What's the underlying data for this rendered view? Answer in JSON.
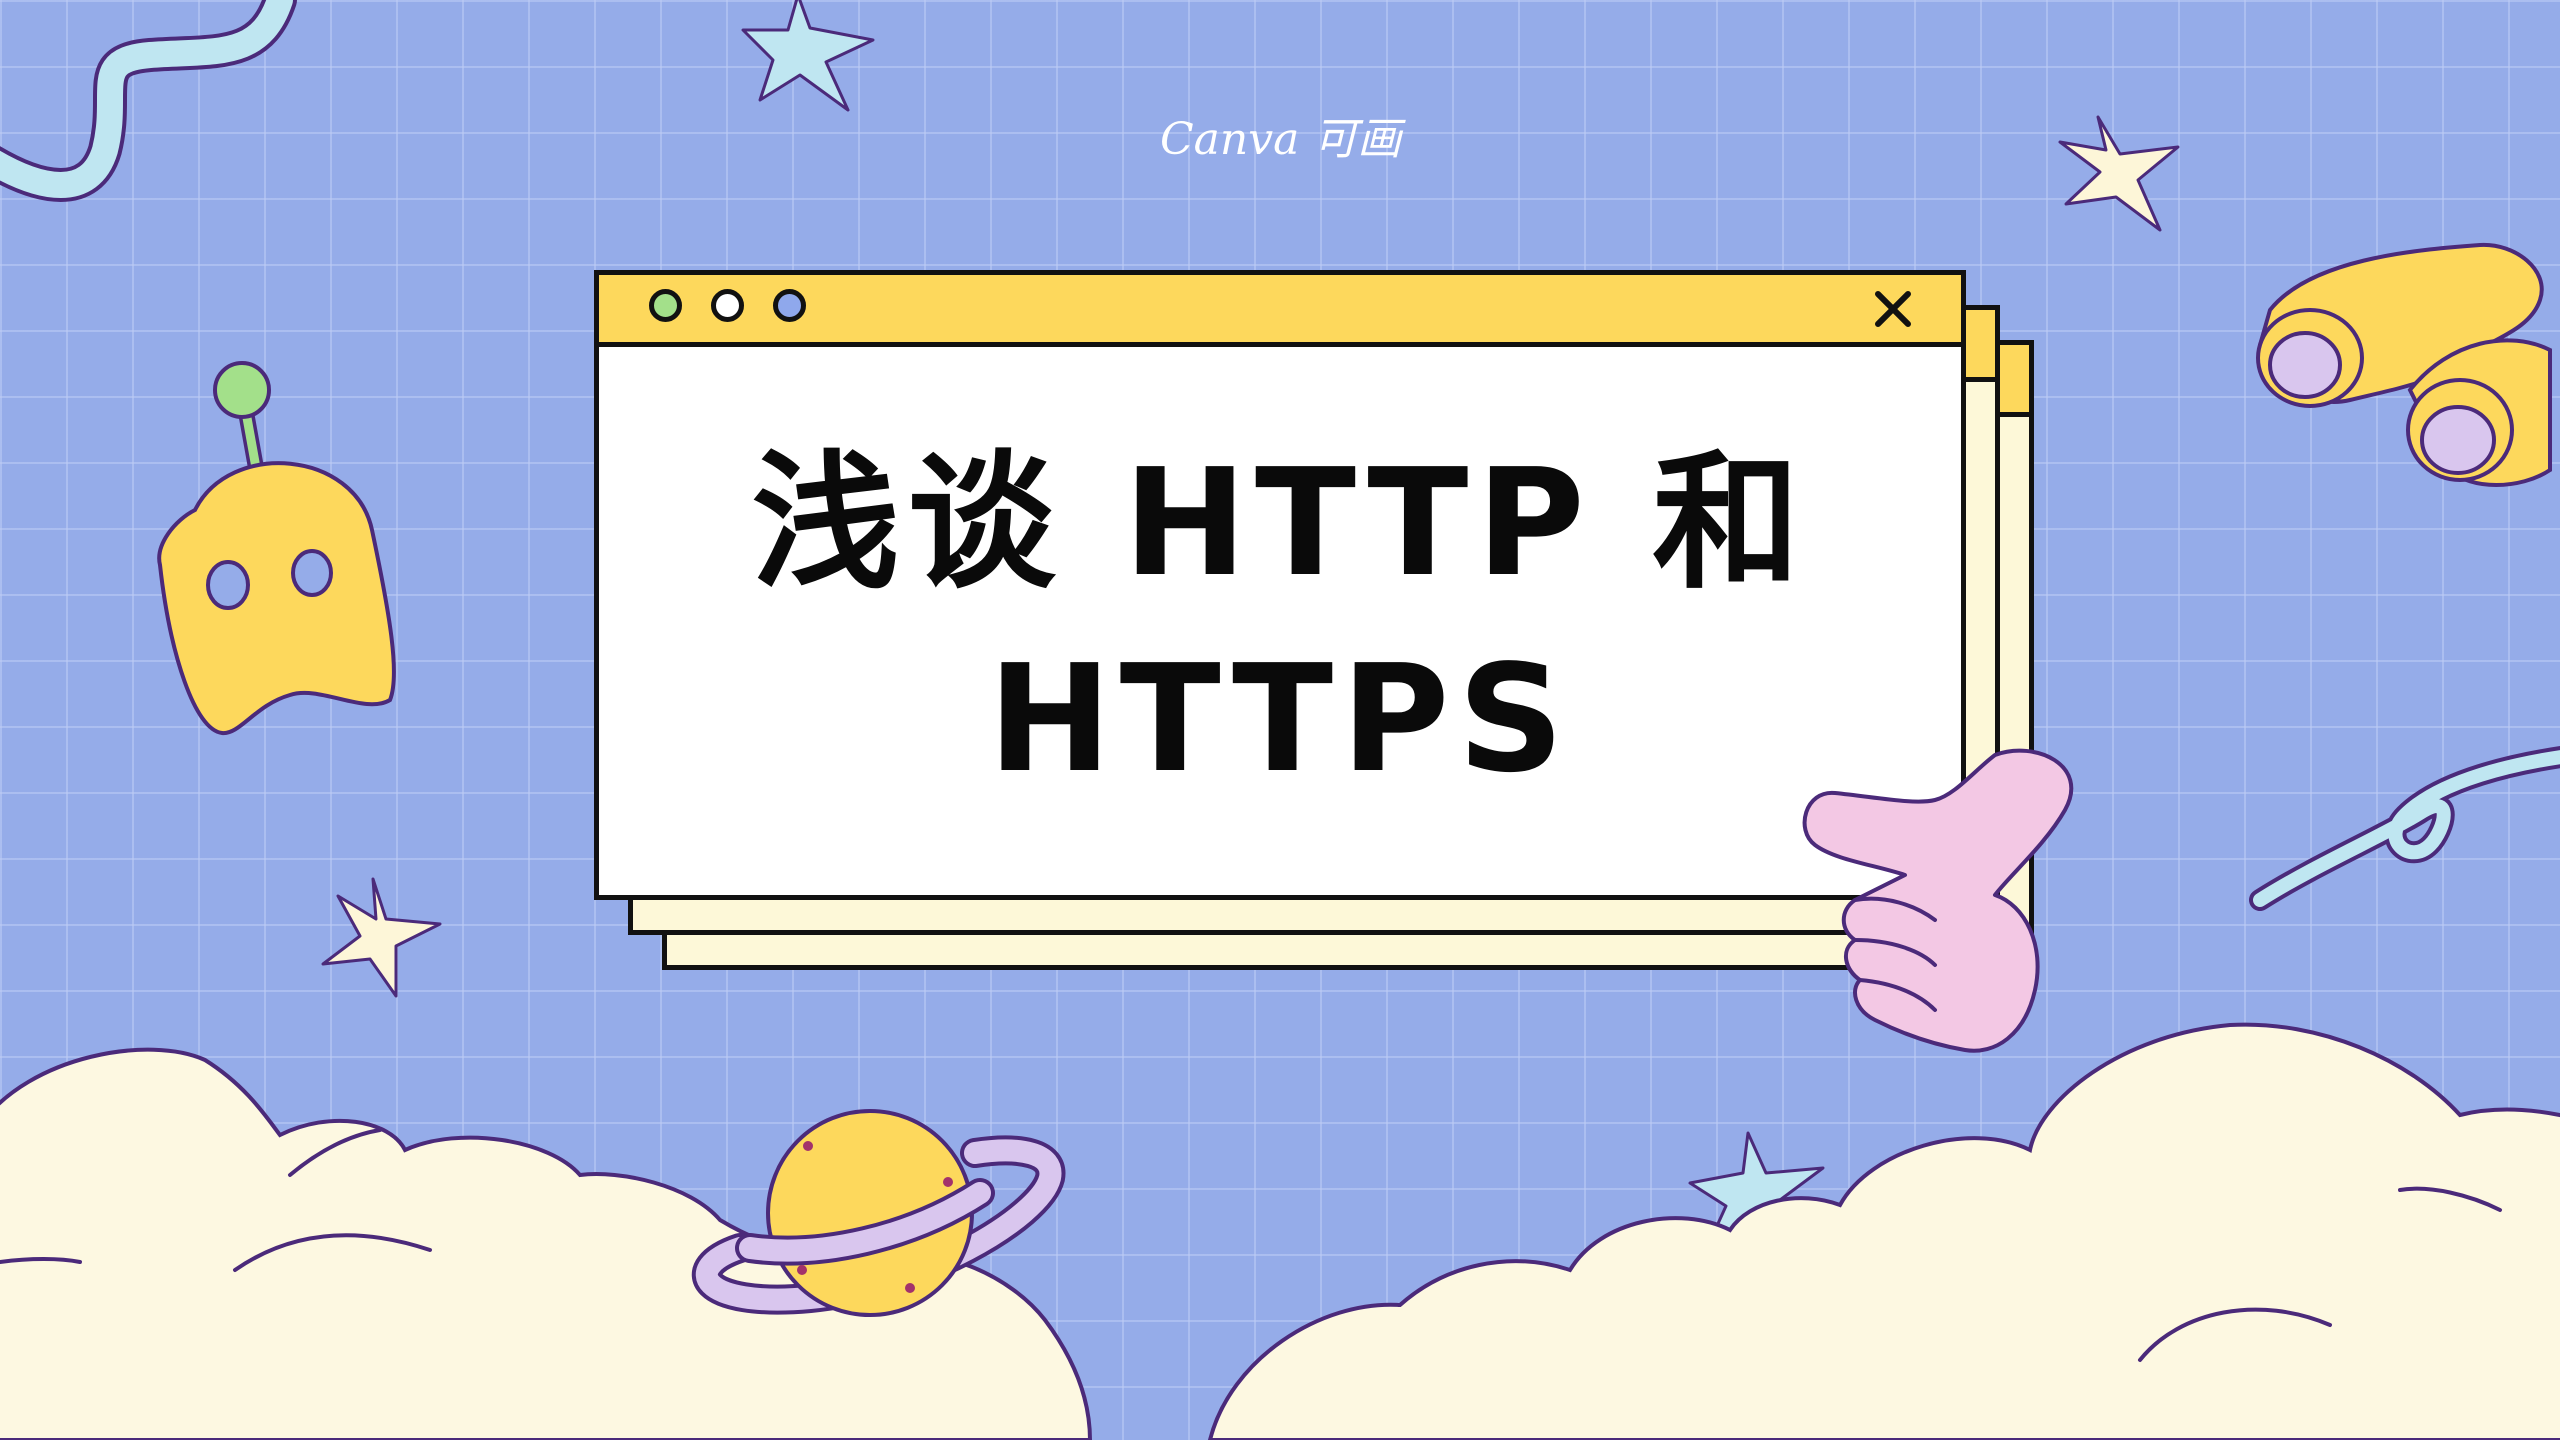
{
  "brand": {
    "logo_text": "Canva 可画"
  },
  "window": {
    "title": "浅谈 HTTP 和\nHTTPS",
    "dots": [
      {
        "name": "green-dot",
        "color": "#a3e08a"
      },
      {
        "name": "white-dot",
        "color": "#ffffff"
      },
      {
        "name": "blue-dot",
        "color": "#8fa8ec"
      }
    ],
    "close_icon": "close-icon"
  },
  "colors": {
    "background": "#95ace9",
    "grid": "#becdf5",
    "window_bar": "#fdd85c",
    "window_back": "#fdf8d8",
    "cloud": "#fdf8e1",
    "outline": "#4b2a7a",
    "ghost": "#fdd85c",
    "planet": "#fdd85c",
    "ring": "#d9c6ee",
    "hand": "#f3c8e4",
    "star_light": "#fdf6d8",
    "star_blue": "#bfe6f1"
  },
  "decorations": [
    "squiggle-ribbon",
    "star-icon",
    "ghost-icon",
    "binoculars-icon",
    "loop-ribbon",
    "pointing-hand-icon",
    "planet-icon",
    "cloud"
  ]
}
